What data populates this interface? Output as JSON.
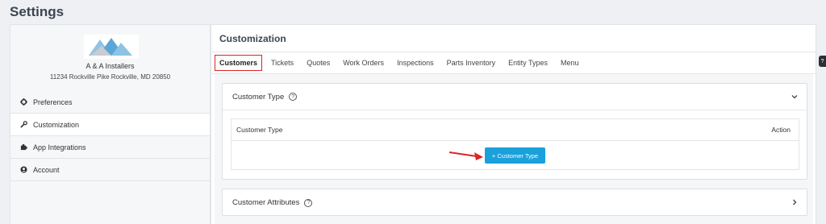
{
  "header": {
    "title": "Settings"
  },
  "sidebar": {
    "company_name": "A & A Installers",
    "company_address": "11234 Rockville Pike Rockville, MD 20850",
    "items": [
      {
        "label": "Preferences",
        "icon": "gear-icon"
      },
      {
        "label": "Customization",
        "icon": "wrench-icon"
      },
      {
        "label": "App Integrations",
        "icon": "puzzle-icon"
      },
      {
        "label": "Account",
        "icon": "user-circle-icon"
      }
    ],
    "active_item": "Customization"
  },
  "main": {
    "title": "Customization",
    "tabs": [
      {
        "label": "Customers"
      },
      {
        "label": "Tickets"
      },
      {
        "label": "Quotes"
      },
      {
        "label": "Work Orders"
      },
      {
        "label": "Inspections"
      },
      {
        "label": "Parts Inventory"
      },
      {
        "label": "Entity Types"
      },
      {
        "label": "Menu"
      }
    ],
    "active_tab": "Customers",
    "panels": {
      "customer_type": {
        "title": "Customer Type",
        "table": {
          "col_type": "Customer Type",
          "col_action": "Action"
        },
        "add_button": "+ Customer Type"
      },
      "customer_attributes": {
        "title": "Customer Attributes"
      }
    }
  },
  "colors": {
    "accent": "#1aa0db",
    "highlight": "#e02424",
    "logo": "#6baed6"
  }
}
